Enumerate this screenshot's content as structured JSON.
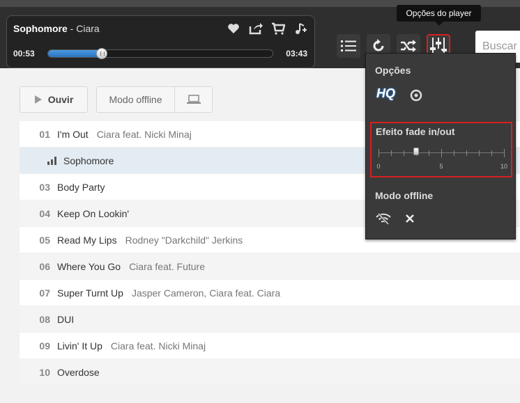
{
  "player": {
    "song": "Sophomore",
    "separator": " - ",
    "artist": "Ciara",
    "current_time": "00:53",
    "total_time": "03:43",
    "progress_fraction": 0.24
  },
  "tooltip": "Opções do player",
  "search": {
    "placeholder": "Buscar"
  },
  "buttons": {
    "play_label": "Ouvir",
    "offline_label": "Modo offline"
  },
  "tracks": [
    {
      "num": "01",
      "name": "I'm Out",
      "artist": "Ciara feat. Nicki Minaj"
    },
    {
      "num": "02",
      "name": "Sophomore",
      "artist": "",
      "playing": true
    },
    {
      "num": "03",
      "name": "Body Party",
      "artist": ""
    },
    {
      "num": "04",
      "name": "Keep On Lookin'",
      "artist": ""
    },
    {
      "num": "05",
      "name": "Read My Lips",
      "artist": "Rodney \"Darkchild\" Jerkins"
    },
    {
      "num": "06",
      "name": "Where You Go",
      "artist": "Ciara feat. Future"
    },
    {
      "num": "07",
      "name": "Super Turnt Up",
      "artist": "Jasper Cameron, Ciara feat. Ciara"
    },
    {
      "num": "08",
      "name": "DUI",
      "artist": ""
    },
    {
      "num": "09",
      "name": "Livin' It Up",
      "artist": "Ciara feat. Nicki Minaj"
    },
    {
      "num": "10",
      "name": "Overdose",
      "artist": ""
    }
  ],
  "dropdown": {
    "options_title": "Opções",
    "hq_label": "HQ",
    "fade_title": "Efeito fade in/out",
    "fade_value": 3,
    "fade_min": 0,
    "fade_max": 10,
    "tick_labels": [
      "0",
      "5",
      "10"
    ],
    "offline_title": "Modo offline"
  },
  "colors": {
    "accent": "#2a72bf",
    "highlight": "#d82020"
  }
}
